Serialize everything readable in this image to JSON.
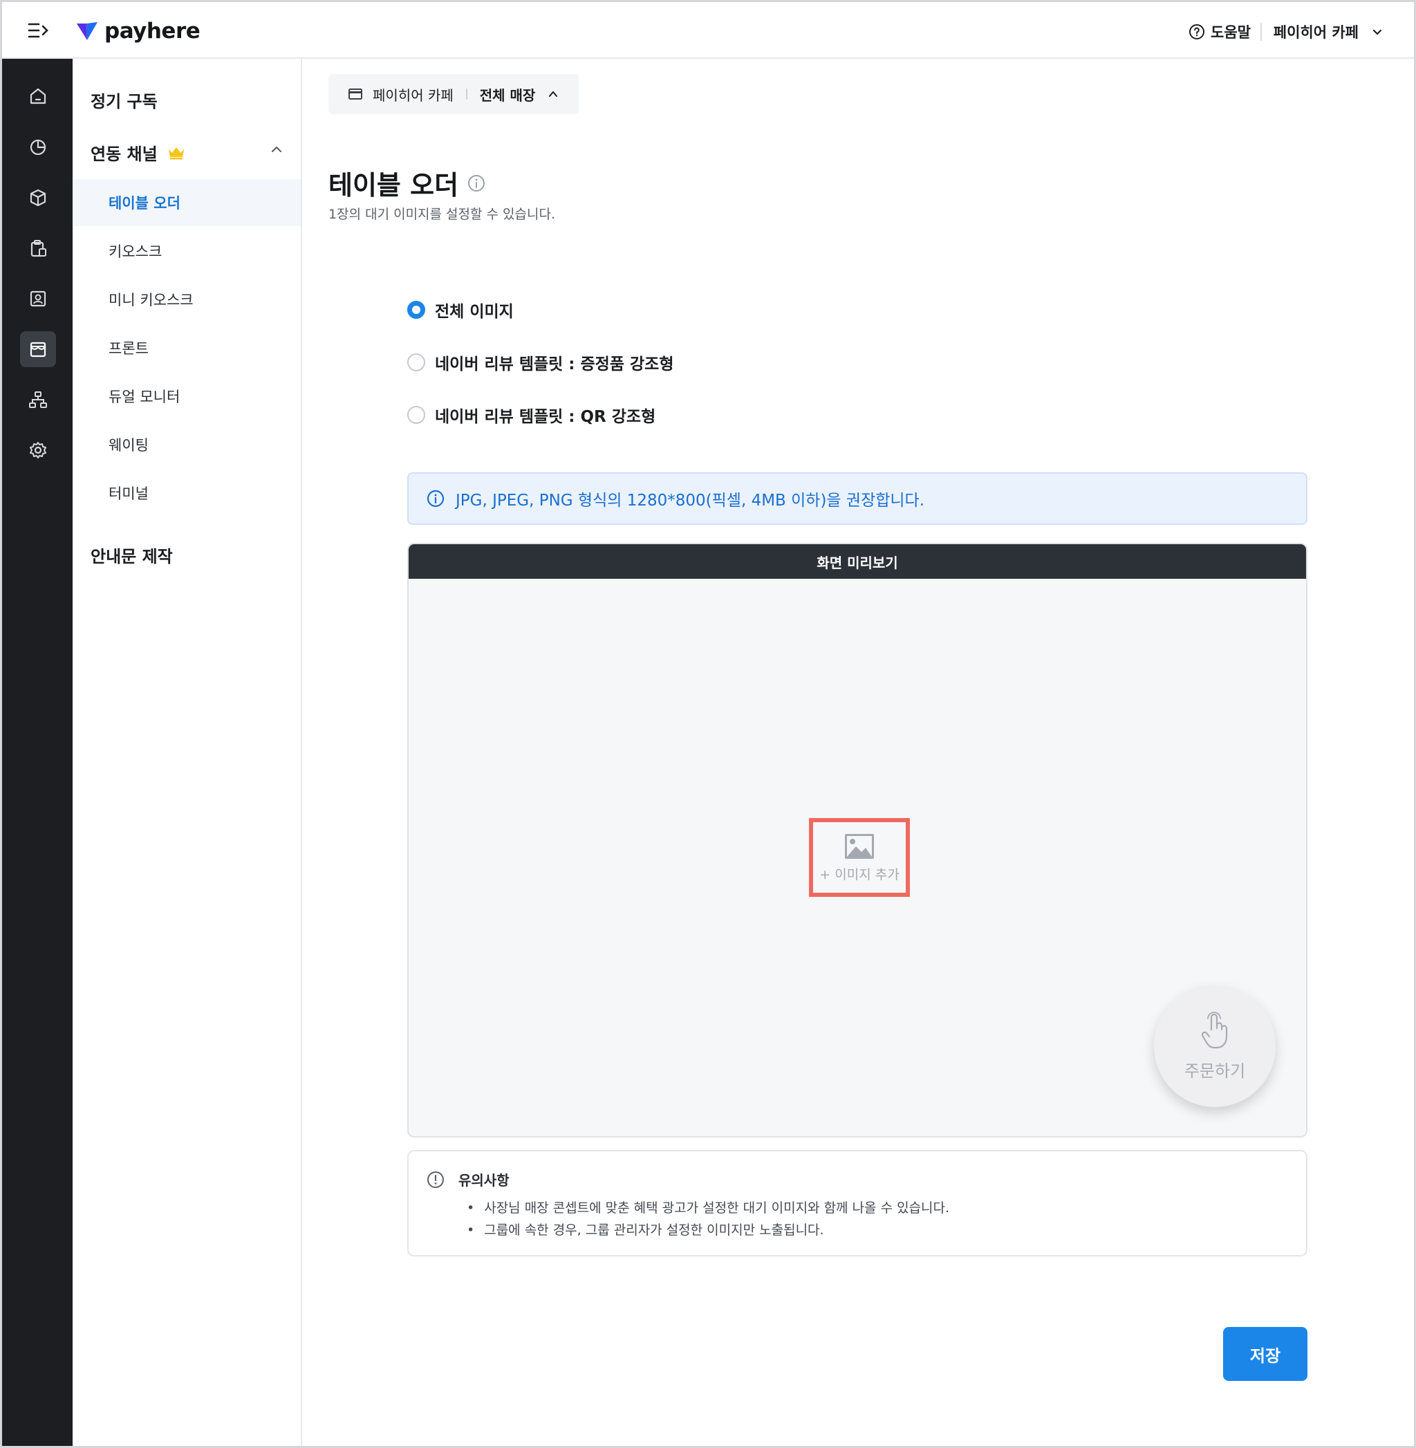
{
  "header": {
    "logo_text": "payhere",
    "help_label": "도움말",
    "store_name": "페이히어 카페"
  },
  "rail": {
    "items": [
      "home-icon",
      "chart-pie-icon",
      "box-icon",
      "clipboard-icon",
      "contact-card-icon",
      "storefront-icon",
      "org-chart-icon",
      "gear-icon"
    ],
    "active_index": 5
  },
  "sidebar": {
    "group_subscription": "정기 구독",
    "group_channels": "연동 채널",
    "channels": [
      {
        "label": "테이블 오더",
        "active": true
      },
      {
        "label": "키오스크"
      },
      {
        "label": "미니 키오스크"
      },
      {
        "label": "프론트"
      },
      {
        "label": "듀얼 모니터"
      },
      {
        "label": "웨이팅"
      },
      {
        "label": "터미널"
      }
    ],
    "group_notice": "안내문 제작"
  },
  "store_chip": {
    "store": "페이히어 카페",
    "scope": "전체 매장"
  },
  "page": {
    "title": "테이블 오더",
    "subtitle": "1장의 대기 이미지를 설정할 수 있습니다."
  },
  "options": [
    {
      "label": "전체 이미지",
      "selected": true
    },
    {
      "label": "네이버 리뷰 템플릿 : 증정품 강조형",
      "selected": false
    },
    {
      "label": "네이버 리뷰 템플릿 : QR 강조형",
      "selected": false
    }
  ],
  "info_notice": "JPG, JPEG, PNG 형식의 1280*800(픽셀, 4MB 이하)을 권장합니다.",
  "preview": {
    "header": "화면 미리보기",
    "add_image": "+ 이미지 추가",
    "order_button": "주문하기"
  },
  "caution": {
    "title": "유의사항",
    "items": [
      "사장님 매장 콘셉트에 맞춘 혜택 광고가 설정한 대기 이미지와 함께 나올 수 있습니다.",
      "그룹에 속한 경우, 그룹 관리자가 설정한 이미지만 노출됩니다."
    ]
  },
  "save_label": "저장",
  "colors": {
    "accent": "#1b86e8",
    "rail_bg": "#1c1e22",
    "highlight_box": "#ee6a5f",
    "crown": "#f5c518"
  }
}
